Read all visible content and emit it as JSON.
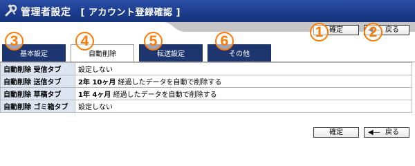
{
  "header": {
    "title": "管理者設定",
    "subtitle": "[ アカウント登録確認 ]",
    "icon": "tools-icon"
  },
  "toolbar": {
    "confirm_label": "確定",
    "back_label": "戻る",
    "back_arrow": "◀—"
  },
  "tabs": [
    {
      "label": "基本設定",
      "active": false
    },
    {
      "label": "自動削除",
      "active": true
    },
    {
      "label": "転送設定",
      "active": false
    },
    {
      "label": "その他",
      "active": false
    }
  ],
  "rows": [
    {
      "key": "自動削除 受信タブ",
      "value_bold": "",
      "value": "設定しない"
    },
    {
      "key": "自動削除 送信タブ",
      "value_bold": "2年 10ヶ月",
      "value": "経過したデータを自動で削除する"
    },
    {
      "key": "自動削除 草稿タブ",
      "value_bold": "1年 4ヶ月",
      "value": "経過したデータを自動で削除する"
    },
    {
      "key": "自動削除 ゴミ箱タブ",
      "value_bold": "",
      "value": "設定しない"
    }
  ],
  "badges": [
    "1",
    "2",
    "3",
    "4",
    "5",
    "6"
  ],
  "colors": {
    "titlebar": "#1c3c8f",
    "tab_inactive": "#1e3670",
    "key_cell": "#dde4f2",
    "badge": "#ff7a00"
  }
}
